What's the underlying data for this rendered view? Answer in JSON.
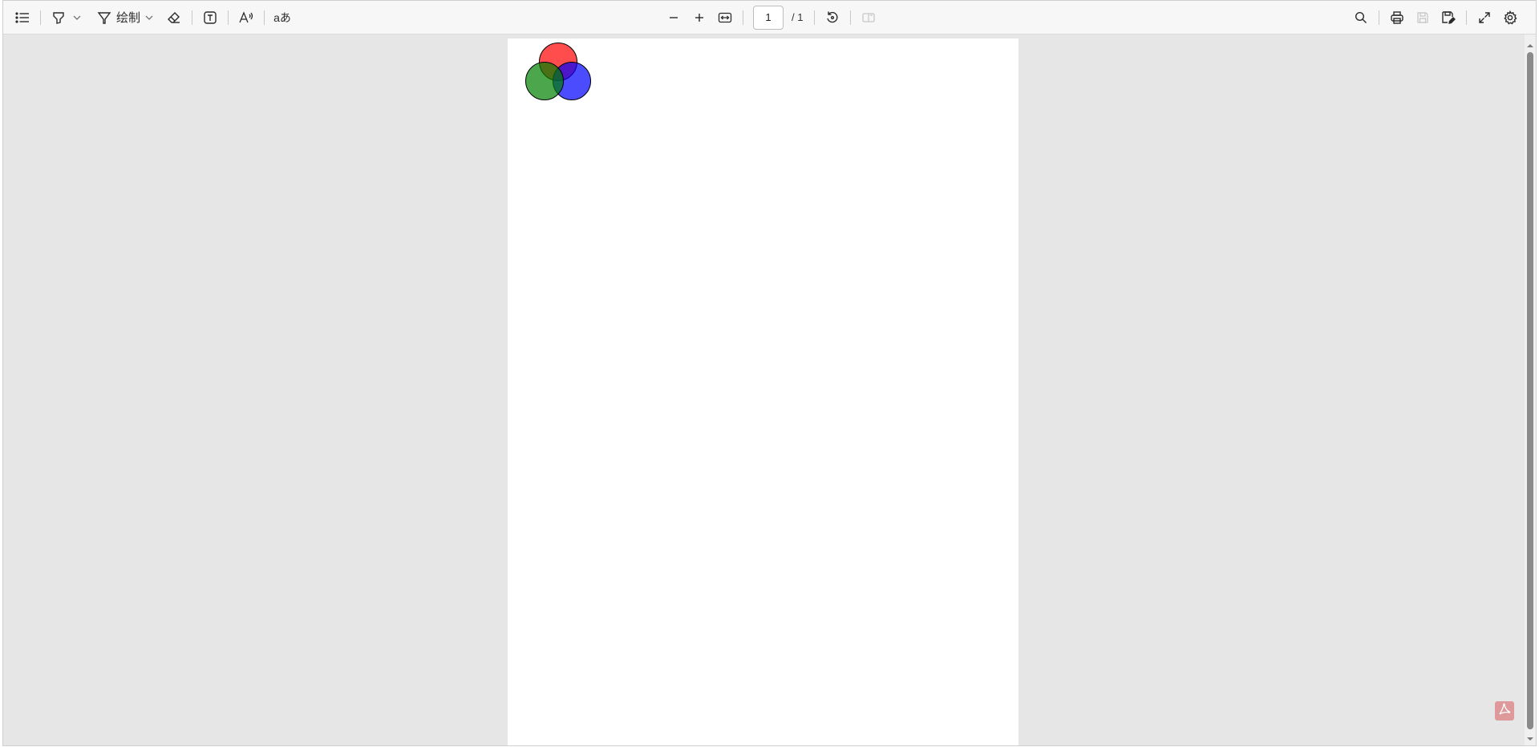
{
  "toolbar": {
    "outline_icon": "list-icon",
    "highlight_icon": "highlighter-icon",
    "draw_icon": "pen-icon",
    "draw_label": "绘制",
    "eraser_icon": "eraser-icon",
    "text_icon": "text-box-icon",
    "read_aloud_icon": "read-aloud-icon",
    "translate_label": "aあ",
    "zoom_out_icon": "minus-icon",
    "zoom_in_icon": "plus-icon",
    "fit_icon": "fit-width-icon",
    "page_number": "1",
    "page_total": "/ 1",
    "rotate_icon": "rotate-icon",
    "view_mode_icon": "two-page-icon",
    "search_icon": "search-icon",
    "print_icon": "printer-icon",
    "save_icon": "save-icon",
    "save_as_icon": "save-as-icon",
    "fullscreen_icon": "expand-icon",
    "settings_icon": "gear-icon"
  },
  "document": {
    "venn_colors": {
      "red": "#ff0000",
      "green": "#008000",
      "blue": "#0000ff"
    }
  },
  "badge": {
    "icon": "acrobat-pdf-icon",
    "color": "#de9a9a"
  }
}
